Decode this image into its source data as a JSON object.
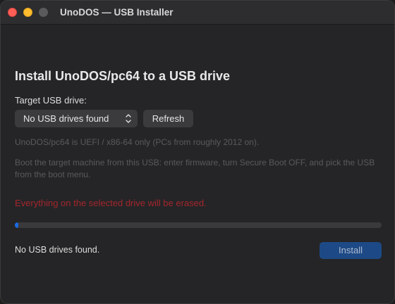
{
  "window": {
    "title": "UnoDOS — USB Installer"
  },
  "main": {
    "heading": "Install UnoDOS/pc64 to a USB drive",
    "target_label": "Target USB drive:",
    "drive_select": {
      "selected": "No USB drives found"
    },
    "refresh_label": "Refresh",
    "note_arch": "UnoDOS/pc64 is UEFI / x86-64 only (PCs from roughly 2012 on).",
    "note_boot": "Boot the target machine from this USB: enter firmware, turn Secure Boot OFF, and pick the USB from the boot menu.",
    "warning": "Everything on the selected drive will be erased.",
    "progress_percent": 1,
    "status": "No USB drives found.",
    "install_label": "Install"
  },
  "colors": {
    "accent": "#1a6be0",
    "warning": "#a4262c",
    "install_button": "#1d4a86"
  },
  "icons": {
    "select_chevron": "chevron-up-down-icon"
  }
}
